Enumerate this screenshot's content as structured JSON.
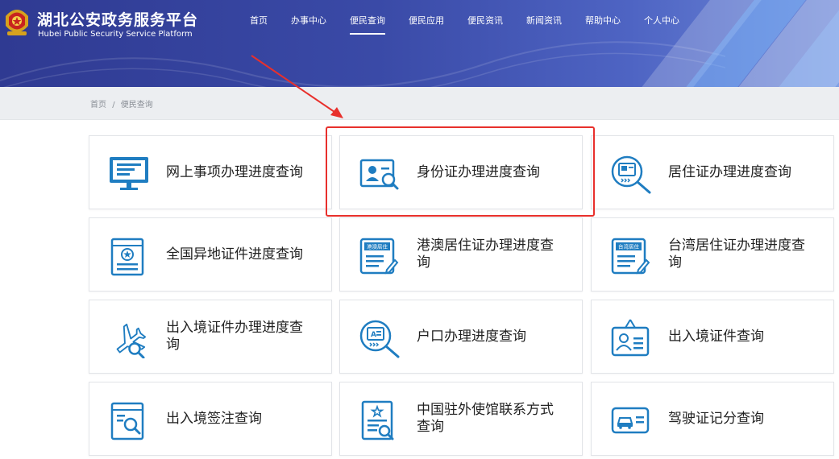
{
  "header": {
    "title": "湖北公安政务服务平台",
    "subtitle": "Hubei Public Security Service Platform",
    "nav": [
      {
        "label": "首页",
        "active": false
      },
      {
        "label": "办事中心",
        "active": false
      },
      {
        "label": "便民查询",
        "active": true
      },
      {
        "label": "便民应用",
        "active": false
      },
      {
        "label": "便民资讯",
        "active": false
      },
      {
        "label": "新闻资讯",
        "active": false
      },
      {
        "label": "帮助中心",
        "active": false
      },
      {
        "label": "个人中心",
        "active": false
      }
    ]
  },
  "breadcrumb": {
    "home": "首页",
    "separator": "/",
    "current": "便民查询"
  },
  "cards": [
    {
      "label": "网上事项办理进度查询",
      "icon": "monitor-icon"
    },
    {
      "label": "身份证办理进度查询",
      "icon": "id-card-search-icon"
    },
    {
      "label": "居住证办理进度查询",
      "icon": "residence-permit-search-icon"
    },
    {
      "label": "全国异地证件进度查询",
      "icon": "certificate-icon"
    },
    {
      "label": "港澳居住证办理进度查询",
      "icon": "hk-macao-permit-icon",
      "badge": "港澳居住"
    },
    {
      "label": "台湾居住证办理进度查询",
      "icon": "taiwan-permit-icon",
      "badge": "台湾居住"
    },
    {
      "label": "出入境证件办理进度查询",
      "icon": "airplane-search-icon"
    },
    {
      "label": "户口办理进度查询",
      "icon": "household-search-icon"
    },
    {
      "label": "出入境证件查询",
      "icon": "badge-id-icon"
    },
    {
      "label": "出入境签注查询",
      "icon": "document-search-icon"
    },
    {
      "label": "中国驻外使馆联系方式查询",
      "icon": "embassy-document-icon"
    },
    {
      "label": "驾驶证记分查询",
      "icon": "driver-license-icon"
    }
  ],
  "colors": {
    "accent": "#1f7dc1",
    "header": "#3a4aa7",
    "highlight": "#e8302c"
  }
}
